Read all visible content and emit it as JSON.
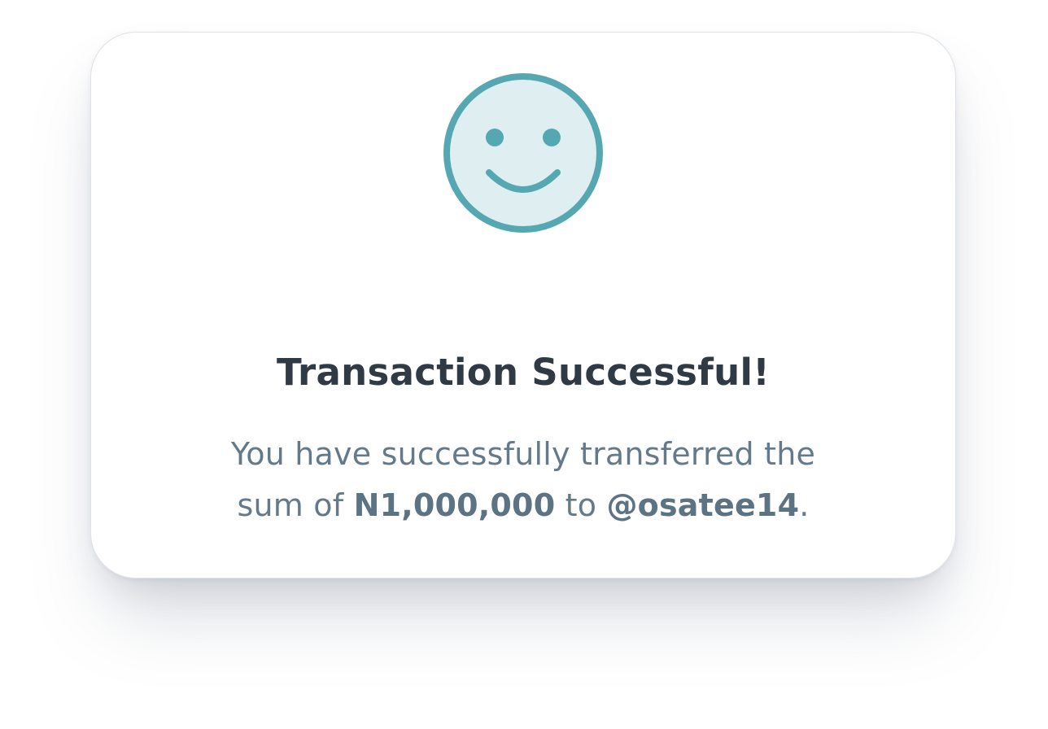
{
  "dialog": {
    "icon": "smiley-face-icon",
    "title": "Transaction Successful!",
    "message": {
      "line1": "You have successfully transferred the",
      "prefix": "sum of ",
      "amount": "N1,000,000",
      "connector": " to ",
      "recipient": "@osatee14",
      "suffix": "."
    }
  },
  "colors": {
    "accent": "#55a8b2",
    "icon_fill": "#deeef1",
    "title": "#2f3a44",
    "message": "#647a8a"
  }
}
